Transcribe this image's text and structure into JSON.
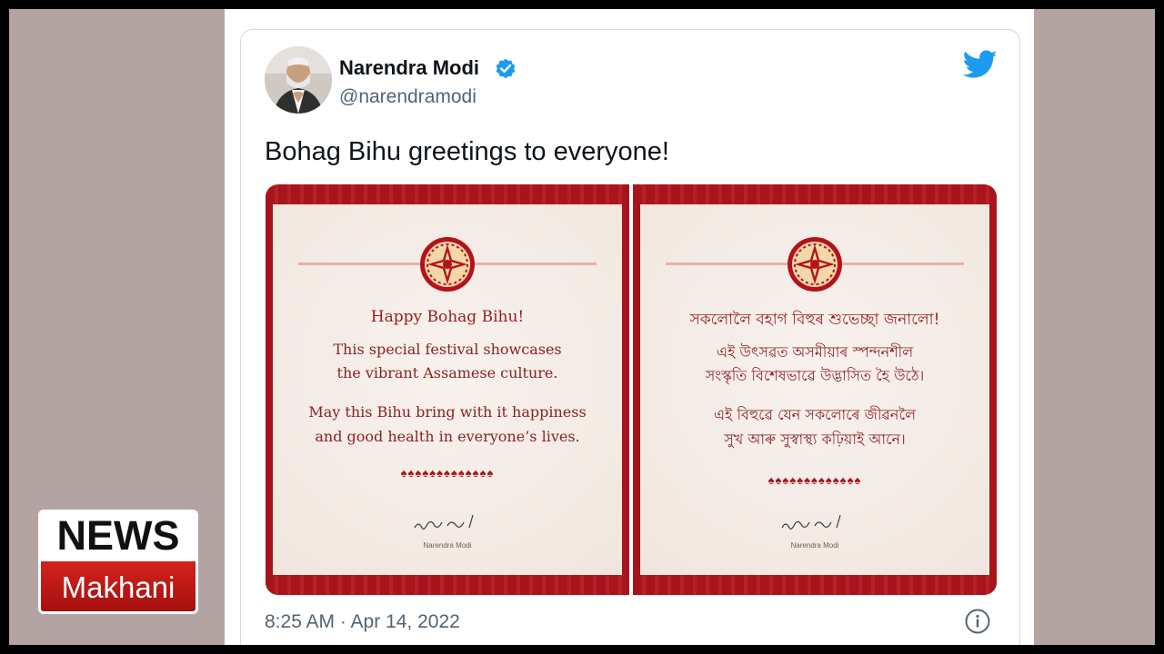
{
  "tweet": {
    "author_name": "Narendra Modi",
    "author_handle": "@narendramodi",
    "text": "Bohag Bihu greetings to everyone!",
    "timestamp": "8:25 AM · Apr 14, 2022"
  },
  "card_english": {
    "title": "Happy Bohag Bihu!",
    "line1": "This special festival showcases",
    "line2": "the vibrant Assamese culture.",
    "line3": "May this Bihu bring with it happiness",
    "line4": "and good health in everyone’s lives.",
    "lotus": "♠♠♠♠♠♠♠♠♠♠♠♠♠",
    "signatory": "Narendra Modi"
  },
  "card_assamese": {
    "title": "সকলোলৈ বহাগ বিহুৰ শুভেচ্ছা জনালো!",
    "line1": "এই উৎসৱত অসমীয়াৰ স্পন্দনশীল",
    "line2": "সংস্কৃতি বিশেষভাৱে উদ্ভাসিত হৈ উঠে।",
    "line3": "এই বিহুৱে যেন সকলোৰে জীৱনলৈ",
    "line4": "সুখ আৰু সুস্বাস্থ্য কঢ়িয়াই আনে।",
    "lotus": "♠♠♠♠♠♠♠♠♠♠♠♠♠",
    "signatory": "Narendra Modi"
  },
  "logo": {
    "top_text": "NEWS",
    "bottom_text": "Makhani"
  },
  "colors": {
    "twitter_blue": "#1d9bf0",
    "card_red": "#a8141c",
    "logo_red": "#c81e1a"
  }
}
